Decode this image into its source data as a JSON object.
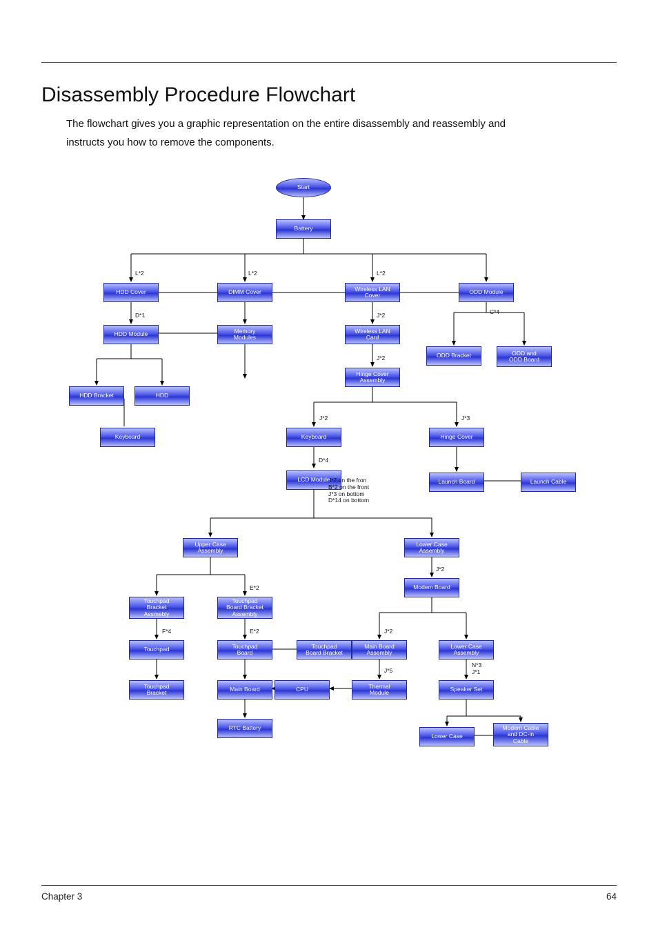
{
  "header": {
    "title": "Disassembly Procedure Flowchart",
    "intro1": "The flowchart gives you a graphic representation on the entire disassembly and reassembly and",
    "intro2": "instructs you how to remove the components."
  },
  "footer": {
    "chapter": "Chapter 3",
    "page": "64"
  },
  "nodes": {
    "start": "Start",
    "battery": "Battery",
    "hdd_cover": "HDD Cover",
    "dimm_cover": "DIMM Cover",
    "wlan_cover": "Wireless LAN\nCover",
    "odd_module": "ODD Module",
    "hdd_module": "HDD Module",
    "memory_modules": "Memory\nModules",
    "wlan_card": "Wireless LAN\nCard",
    "odd_bracket": "ODD Bracket",
    "odd_odd_board": "ODD and\nODD Board",
    "hdd_bracket": "HDD Bracket",
    "hdd": "HDD",
    "hinge_cover_asm": "Hinge Cover\nAssembly",
    "keyboard1": "Keyboard",
    "keyboard2": "Keyboard",
    "hinge_cover": "Hinge Cover",
    "lcd_module": "LCD Module",
    "launch_board": "Launch Board",
    "launch_cable": "Launch Cable",
    "upper_case_asm": "Upper Case\nAssembly",
    "lower_case_asm": "Lower Case\nAssembly",
    "modem_board": "Modem Board",
    "tp_bracket_asm": "Touchpad\nBracket\nAssmebly",
    "tp_board_bracket_asm": "Touchpad\nBoard Bracket\nAssembly",
    "touchpad": "Touchpad",
    "tp_board": "Touchpad\nBoard",
    "tp_board_bracket": "Touchpad\nBoard Bracket",
    "main_board_asm": "Main Board\nAssembly",
    "lower_case_asm2": "Lower Case\nAssembly",
    "tp_bracket": "Touchpad\nBracket",
    "main_board": "Main Board",
    "cpu": "CPU",
    "thermal_module": "Thermal\nModule",
    "speaker_set": "Speaker Set",
    "rtc_battery": "RTC Battery",
    "lower_case": "Lower Case",
    "modem_dcin_cable": "Modem Cable\nand DC-in\nCable"
  },
  "screws": {
    "l2_a": "L*2",
    "l2_b": "L*2",
    "l2_c": "L*2",
    "d1": "D*1",
    "j2_wlan": "J*2",
    "c4": "C*4",
    "j2_hinge": "J*2",
    "j2_kb": "J*2",
    "j3_hinge": "J*3",
    "d4": "D*4",
    "lcd_follow": "J*7 on the fron\nB*2 on the front\nJ*3 on bottom\nD*14 on bottom",
    "j2_modem": "J*2",
    "e2_a": "E*2",
    "e2_b": "E*2",
    "f4": "F*4",
    "j2_mb": "J*2",
    "j5": "J*5",
    "n3_j1": "N*3\nJ*1"
  }
}
